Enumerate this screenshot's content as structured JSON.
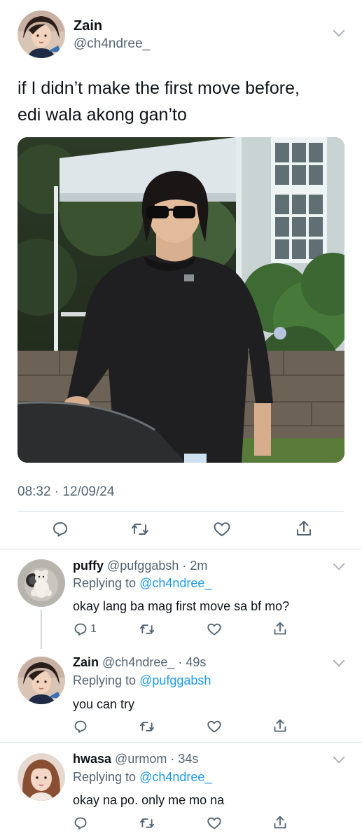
{
  "main_tweet": {
    "author_name": "Zain",
    "author_handle": "@ch4ndree_",
    "text_line1": "if I didn’t make the first move before,",
    "text_line2": "edi wala akong gan’to",
    "timestamp": "08:32 · 12/09/24",
    "actions": [
      "reply-icon",
      "retweet-icon",
      "like-icon",
      "share-icon"
    ]
  },
  "replies": [
    {
      "name": "puffy",
      "handle": "@pufggabsh",
      "time": "· 2m",
      "replying_label": "Replying to",
      "replying_to": "@ch4ndree_",
      "text": "okay lang ba mag first move sa bf mo?",
      "reply_count": "1"
    },
    {
      "name": "Zain",
      "handle": "@ch4ndree_",
      "time": "· 49s",
      "replying_label": "Replying to",
      "replying_to": "@pufggabsh",
      "text": "you can try",
      "reply_count": ""
    },
    {
      "name": "hwasa",
      "handle": "@urmom",
      "time": "· 34s",
      "replying_label": "Replying to",
      "replying_to": "@ch4ndree_",
      "text": "okay na po. only me mo na",
      "reply_count": ""
    }
  ],
  "colors": {
    "text": "#0f1419",
    "muted": "#536471",
    "link": "#1d9bf0",
    "divider": "#e1e8ed"
  }
}
